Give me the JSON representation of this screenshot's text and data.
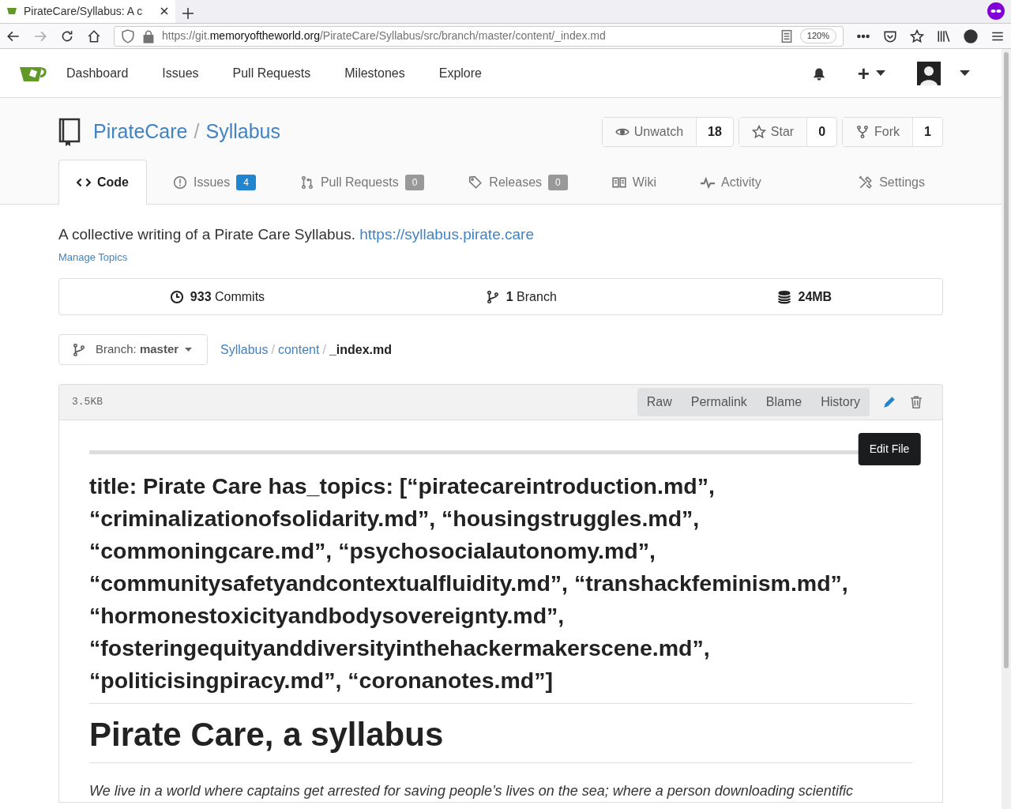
{
  "browser": {
    "tab_title": "PirateCare/Syllabus: A c",
    "url_prefix": "https://git.",
    "url_domain": "memoryoftheworld.org",
    "url_path": "/PirateCare/Syllabus/src/branch/master/content/_index.md",
    "zoom": "120%"
  },
  "nav": {
    "items": [
      "Dashboard",
      "Issues",
      "Pull Requests",
      "Milestones",
      "Explore"
    ],
    "plus": "+"
  },
  "repo": {
    "owner": "PirateCare",
    "separator": "/",
    "name": "Syllabus",
    "buttons": [
      {
        "kind": "watch",
        "label": "Unwatch",
        "count": "18"
      },
      {
        "kind": "star",
        "label": "Star",
        "count": "0"
      },
      {
        "kind": "fork",
        "label": "Fork",
        "count": "1"
      }
    ]
  },
  "tabs": [
    {
      "kind": "code",
      "label": "Code",
      "selected": true
    },
    {
      "kind": "issues",
      "label": "Issues",
      "count": "4",
      "selected": false
    },
    {
      "kind": "pulls",
      "label": "Pull Requests",
      "count": "0",
      "selected": false
    },
    {
      "kind": "releases",
      "label": "Releases",
      "count": "0",
      "selected": false
    },
    {
      "kind": "wiki",
      "label": "Wiki",
      "selected": false
    },
    {
      "kind": "activity",
      "label": "Activity",
      "selected": false
    },
    {
      "kind": "settings",
      "label": "Settings",
      "selected": false
    }
  ],
  "description": {
    "text": "A collective writing of a Pirate Care Syllabus.",
    "link": "https://syllabus.pirate.care",
    "manage_topics": "Manage Topics"
  },
  "stats": [
    {
      "kind": "commits",
      "text": "**933** Commits"
    },
    {
      "kind": "branch",
      "text": "**1** Branch"
    },
    {
      "kind": "size",
      "text": "**24MB**"
    }
  ],
  "branch": {
    "label": "Branch:",
    "value": "master"
  },
  "breadcrumb": {
    "separator": "/",
    "items": [
      {
        "text": "Syllabus",
        "current": false
      },
      {
        "text": "content",
        "current": false
      },
      {
        "text": "_index.md",
        "current": true
      }
    ]
  },
  "file": {
    "size": "3.5KB",
    "actions": [
      "Raw",
      "Permalink",
      "Blame",
      "History"
    ],
    "tooltip": "Edit File"
  },
  "content": {
    "front_matter": "title: Pirate Care has_topics: [“piratecareintroduction.md”, “criminalizationofsolidarity.md”, “housingstruggles.md”, “commoningcare.md”, “psychosocialautonomy.md”, “communitysafetyandcontextualfluidity.md”, “transhackfeminism.md”, “hormonestoxicityandbodysovereignty.md”, “fosteringequityanddiversityinthehackermakerscene.md”, “politicisingpiracy.md”, “coronanotes.md”]",
    "heading": "Pirate Care, a syllabus",
    "paragraph": "We live in a world where captains get arrested for saving people’s lives on the sea; where a person downloading scientific"
  }
}
